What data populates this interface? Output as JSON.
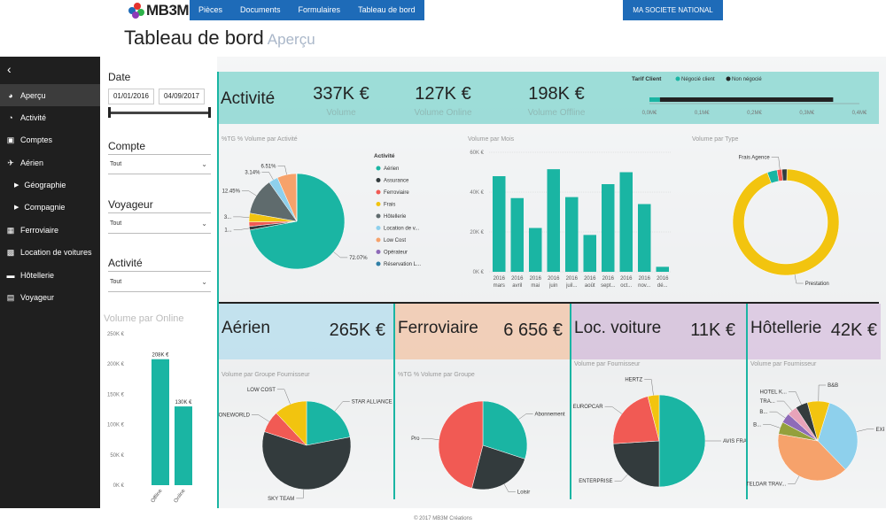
{
  "header": {
    "logo_text": "MB3M",
    "nav": [
      "Pièces",
      "Documents",
      "Formulaires",
      "Tableau de bord"
    ],
    "company": "MA SOCIETE NATIONAL",
    "title": "Tableau de bord",
    "subtitle": "Aperçu"
  },
  "sidebar": {
    "items": [
      {
        "label": "Aperçu",
        "icon": "dashboard-icon"
      },
      {
        "label": "Activité",
        "icon": "pie-icon"
      },
      {
        "label": "Comptes",
        "icon": "document-icon"
      },
      {
        "label": "Aérien",
        "icon": "plane-icon"
      },
      {
        "label": "Géographie",
        "icon": "caret-icon"
      },
      {
        "label": "Compagnie",
        "icon": "caret-icon"
      },
      {
        "label": "Ferroviaire",
        "icon": "train-icon"
      },
      {
        "label": "Location de voitures",
        "icon": "car-icon"
      },
      {
        "label": "Hôtellerie",
        "icon": "bed-icon"
      },
      {
        "label": "Voyageur",
        "icon": "briefcase-icon"
      }
    ]
  },
  "filters": {
    "date_label": "Date",
    "date_from": "01/01/2016",
    "date_to": "04/09/2017",
    "compte_label": "Compte",
    "compte_value": "Tout",
    "voyageur_label": "Voyageur",
    "voyageur_value": "Tout",
    "activite_label": "Activité",
    "activite_value": "Tout"
  },
  "kpis": {
    "activite_title": "Activité",
    "volume": "337K €",
    "volume_label": "Volume",
    "volume_online": "127K €",
    "volume_online_label": "Volume Online",
    "volume_offline": "198K €",
    "volume_offline_label": "Volume Offline",
    "aerien_title": "Aérien",
    "aerien_value": "265K €",
    "ferroviaire_title": "Ferroviaire",
    "ferroviaire_value": "6 656 €",
    "loc_title": "Loc. voiture",
    "loc_value": "11K €",
    "hotel_title": "Hôtellerie",
    "hotel_value": "42K €"
  },
  "colors": {
    "teal": "#1ab5a3",
    "dark": "#333b3d",
    "red": "#f15a54",
    "yellow": "#f2c40f",
    "purple": "#8e6bb8",
    "blue": "#1e6bb8",
    "gray": "#5f6b6d",
    "lightblue": "#8ed0ec",
    "orange": "#f6a26b",
    "olive": "#94a03c"
  },
  "footer": "© 2017 MB3M Créations",
  "chart_data": [
    {
      "id": "tarif",
      "type": "bar",
      "title": "Tarif Client",
      "series": [
        {
          "name": "Négocié client",
          "values": [
            0.02
          ]
        },
        {
          "name": "Non négocié",
          "values": [
            0.33
          ]
        }
      ],
      "ticks": [
        "0,0M€",
        "0,1M€",
        "0,2M€",
        "0,3M€",
        "0,4M€"
      ],
      "xlim": [
        0,
        0.4
      ]
    },
    {
      "id": "activite",
      "type": "pie",
      "title": "%TG % Volume par Activité",
      "legend_title": "Activité",
      "labels": [
        "Aérien",
        "Assurance",
        "Ferroviaire",
        "Frais",
        "Hôtellerie",
        "Location de v...",
        "Low Cost",
        "Opérateur",
        "Réservation L..."
      ],
      "values": [
        72.07,
        1.2,
        1.5,
        3.0,
        12.45,
        3.14,
        6.51,
        0.1,
        0.03
      ],
      "slice_labels": [
        "72.07%",
        "1...",
        "",
        "3...",
        "12.45%",
        "3.14%",
        "6.51%",
        "",
        ""
      ]
    },
    {
      "id": "volume_mois",
      "type": "bar",
      "title": "Volume par Mois",
      "categories": [
        "2016 mars",
        "2016 avril",
        "2016 mai",
        "2016 juin",
        "2016 juil...",
        "2016 août",
        "2016 sept...",
        "2016 oct...",
        "2016 nov...",
        "2016 dé..."
      ],
      "values": [
        48000,
        37000,
        22000,
        51500,
        37500,
        18500,
        44000,
        50000,
        34000,
        2500
      ],
      "ticks": [
        "60K €",
        "40K €",
        "20K €",
        "0K €"
      ],
      "ylim": [
        0,
        60000
      ]
    },
    {
      "id": "volume_type",
      "type": "pie",
      "title": "Volume par Type",
      "labels": [
        "Prestation",
        "Frais Agence"
      ],
      "values": [
        94,
        6
      ]
    },
    {
      "id": "volume_online",
      "type": "bar",
      "title": "Volume par Online",
      "categories": [
        "Offline",
        "Online"
      ],
      "values": [
        208000,
        130000
      ],
      "data_labels": [
        "208K €",
        "130K €"
      ],
      "ticks": [
        "250K €",
        "200K €",
        "150K €",
        "100K €",
        "50K €",
        "0K €"
      ],
      "ylim": [
        0,
        250000
      ]
    },
    {
      "id": "aerien_pie",
      "type": "pie",
      "title": "Volume par Groupe Fournisseur",
      "labels": [
        "STAR ALLIANCE",
        "SKY TEAM",
        "ONEWORLD",
        "LOW COST"
      ],
      "values": [
        22,
        58,
        8,
        12
      ]
    },
    {
      "id": "ferro_pie",
      "type": "pie",
      "title": "%TG % Volume par Groupe",
      "labels": [
        "Abonnement",
        "Loisir",
        "Pro"
      ],
      "values": [
        30,
        24,
        46
      ]
    },
    {
      "id": "loc_pie",
      "type": "pie",
      "title": "Volume par Fournisseur",
      "labels": [
        "AVIS FRANCE",
        "ENTERPRISE",
        "EUROPCAR",
        "HERTZ"
      ],
      "values": [
        50,
        24,
        22,
        4
      ]
    },
    {
      "id": "hotel_pie",
      "type": "pie",
      "title": "Volume par Fournisseur",
      "labels": [
        "EXPEDIA",
        "TELDAR TRAV...",
        "B...",
        "B...",
        "TRA...",
        "HOTEL K...",
        "B&B"
      ],
      "values": [
        33,
        40,
        5,
        4,
        4,
        5,
        9
      ]
    }
  ]
}
